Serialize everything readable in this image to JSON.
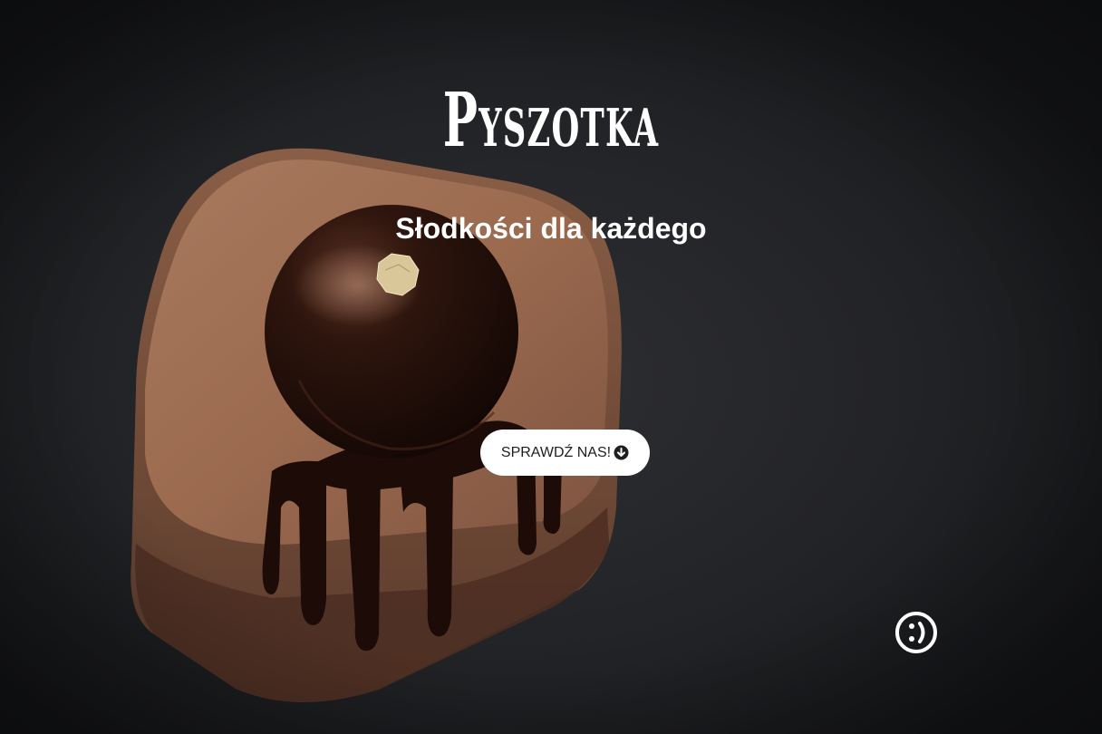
{
  "hero": {
    "brand_title": "Pyszotka",
    "tagline": "Słodkości dla każdego",
    "cta_label": "SPRAWDŹ NAS!",
    "cta_icon": "arrow-down-circle-icon",
    "background_image": "chocolate-dessert-photo"
  },
  "widgets": {
    "accessibility_icon": "smiley-face-icon"
  },
  "colors": {
    "background": "#1a1b1e",
    "text": "#ffffff",
    "button_bg": "#ffffff",
    "button_text": "#1e1e1e",
    "cake_mousse": "#9a6a50",
    "chocolate": "#2a130c"
  }
}
